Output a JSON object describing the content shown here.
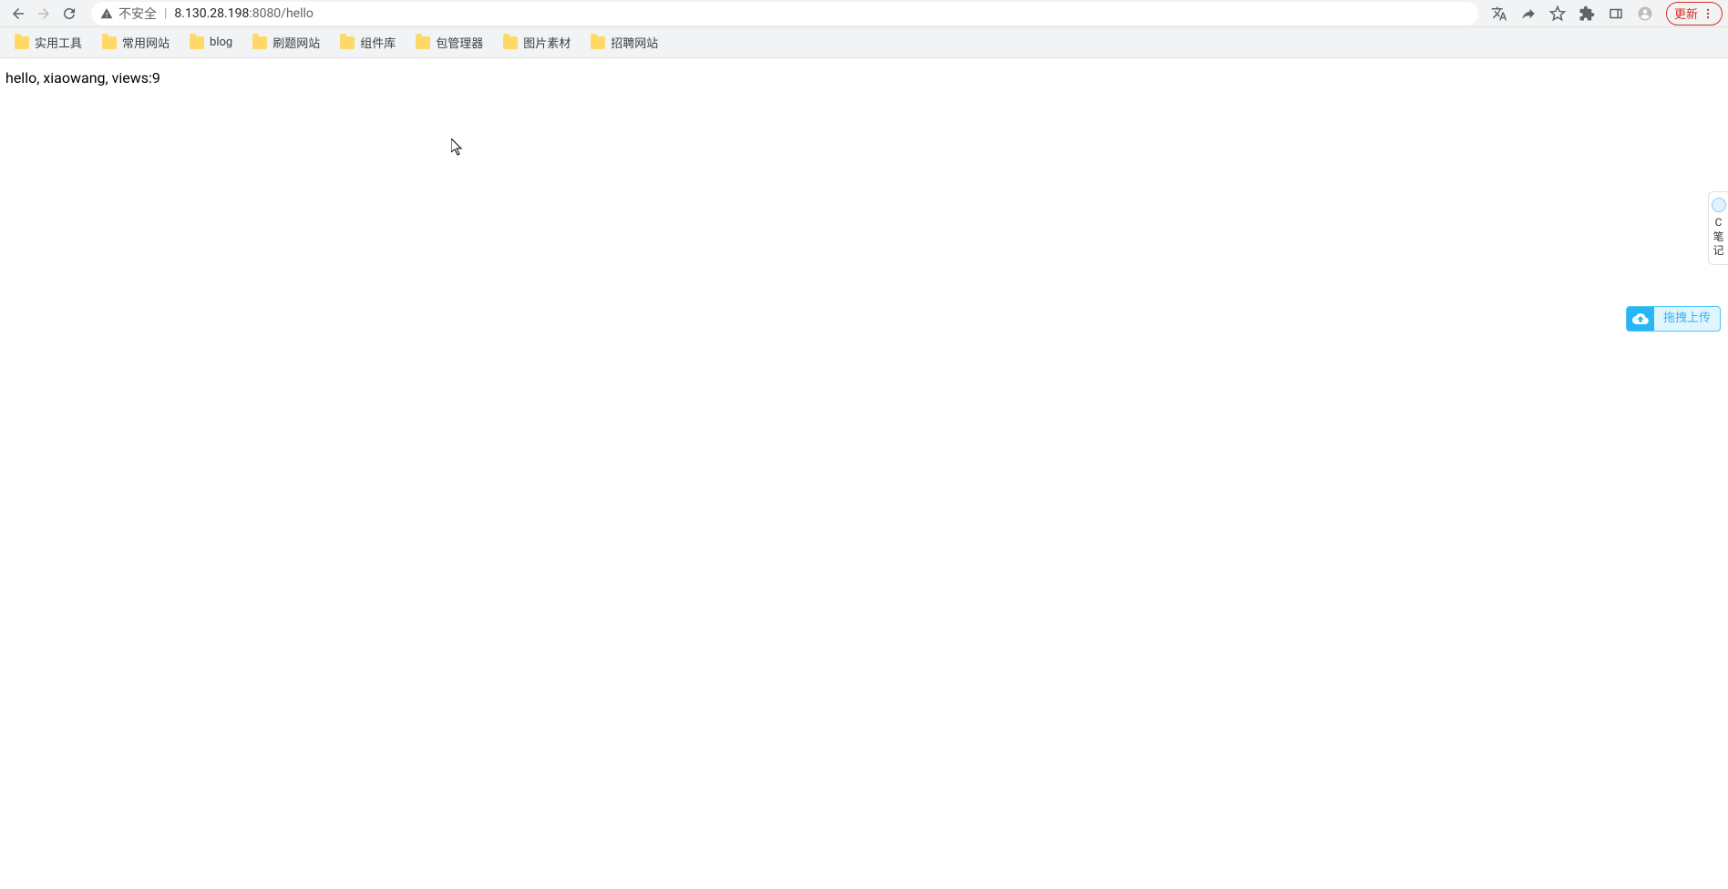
{
  "toolbar": {
    "security_label": "不安全",
    "address_host": "8.130.28.198",
    "address_port_path": ":8080/hello",
    "update_label": "更新"
  },
  "bookmarks": [
    {
      "label": "实用工具"
    },
    {
      "label": "常用网站"
    },
    {
      "label": "blog"
    },
    {
      "label": "刷题网站"
    },
    {
      "label": "组件库"
    },
    {
      "label": "包管理器"
    },
    {
      "label": "图片素材"
    },
    {
      "label": "招聘网站"
    }
  ],
  "page": {
    "body_text": "hello, xiaowang, views:9"
  },
  "side_widget": {
    "line1": "C",
    "line2": "笔",
    "line3": "记"
  },
  "upload_widget": {
    "label": "拖拽上传"
  }
}
